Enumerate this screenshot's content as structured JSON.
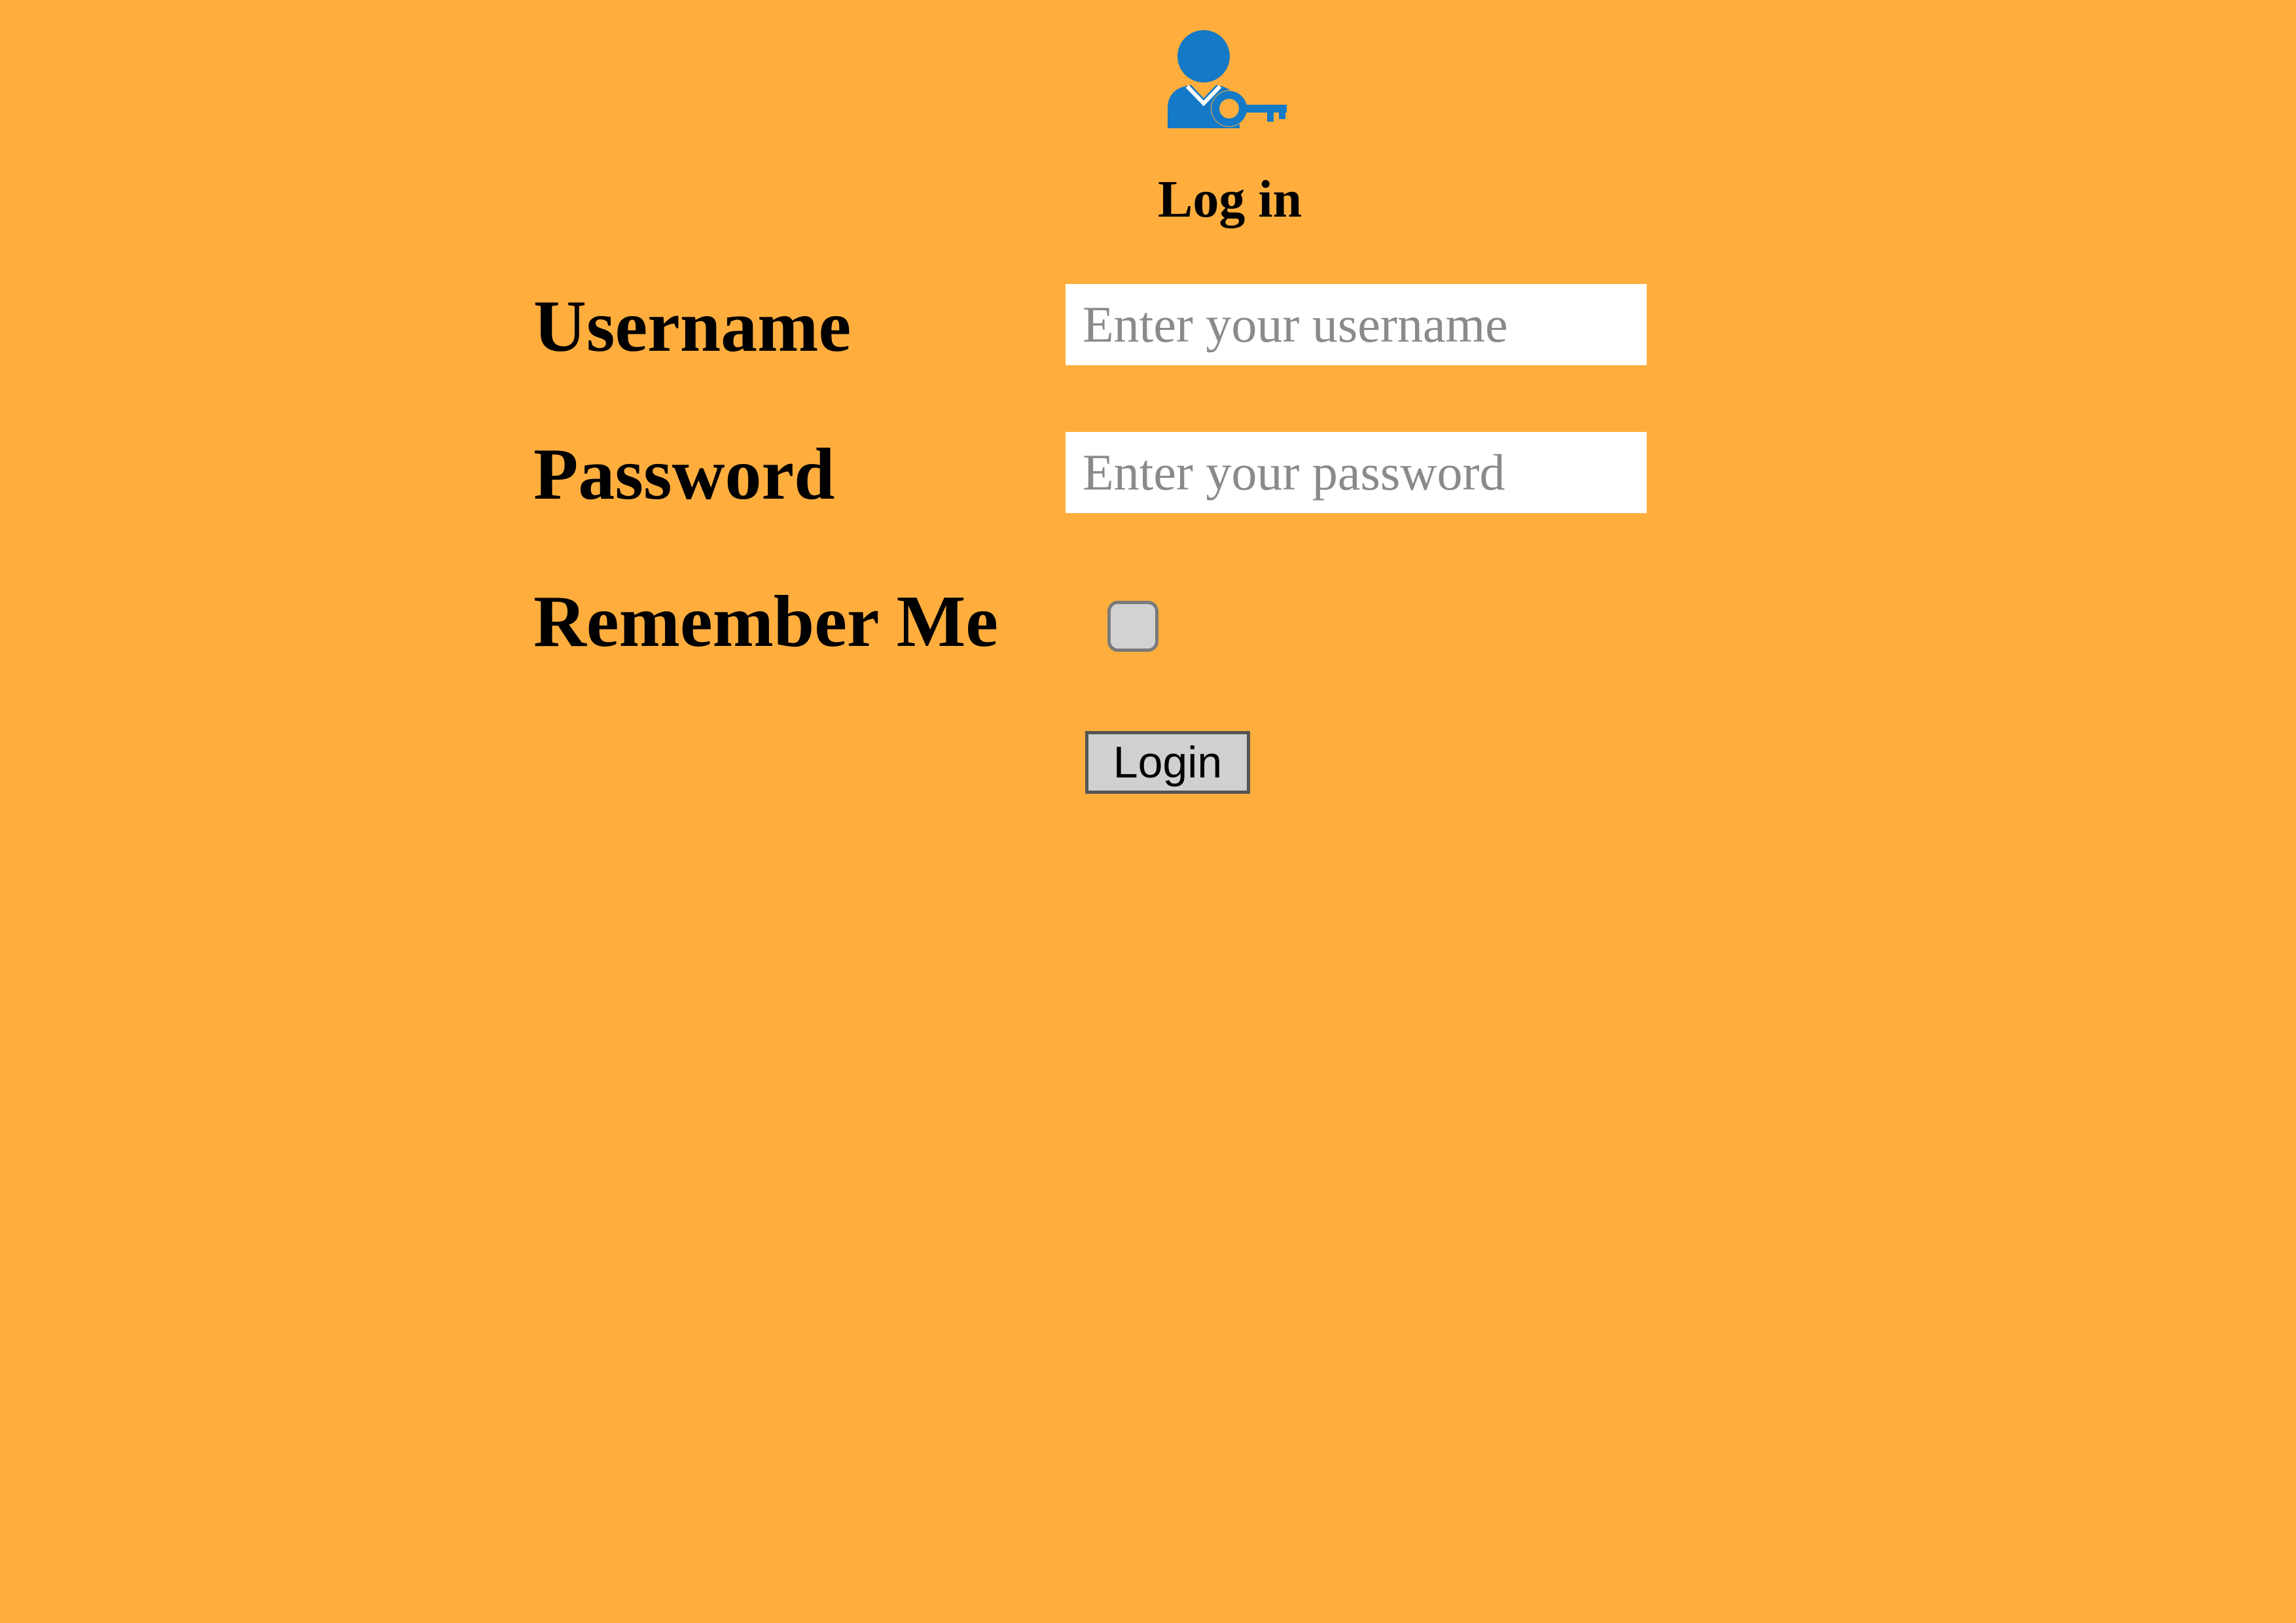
{
  "header": {
    "logo_icon": "user-key-icon",
    "title": "Log in"
  },
  "form": {
    "username": {
      "label": "Username",
      "placeholder": "Enter your username",
      "value": ""
    },
    "password": {
      "label": "Password",
      "placeholder": "Enter your password",
      "value": ""
    },
    "remember_me": {
      "label": "Remember Me",
      "checked": false
    },
    "submit_label": "Login"
  },
  "colors": {
    "background": "#FFAE3E",
    "icon_blue": "#1479C6",
    "input_background": "#FFFFFF",
    "placeholder": "#8A8A8A",
    "button_background": "#D0D0D0"
  }
}
